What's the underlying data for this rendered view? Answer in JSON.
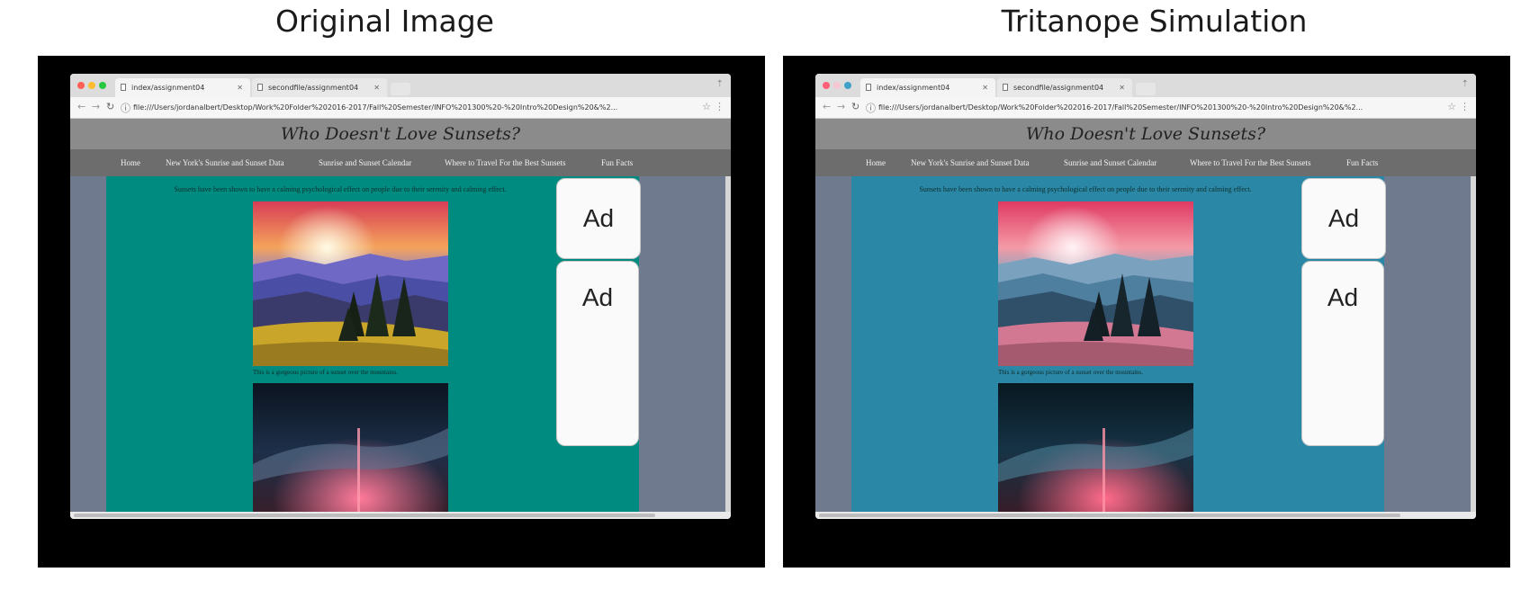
{
  "titles": {
    "left": "Original Image",
    "right": "Tritanope Simulation"
  },
  "browser": {
    "tabs": [
      "index/assignment04",
      "secondfile/assignment04"
    ],
    "url": "file:///Users/jordanalbert/Desktop/Work%20Folder%202016-2017/Fall%20Semester/INFO%201300%20-%20Intro%20Design%20&%2...",
    "site_title": "Who Doesn't Love Sunsets?",
    "nav": [
      "Home",
      "New York's Sunrise and Sunset Data",
      "Sunrise and Sunset Calendar",
      "Where to Travel For the Best Sunsets",
      "Fun Facts"
    ],
    "intro": "Sunsets have been shown to have a calming psychological effect on people due to their serenity and calming effect.",
    "caption": "This is a gorgeous picture of a sunset over the mountains.",
    "ad_labels": [
      "Ad",
      "Ad"
    ]
  },
  "colors": {
    "original_content_bg": "#008b80",
    "tritanope_content_bg": "#2b87a6"
  },
  "icons": [
    "doc-icon",
    "close-icon",
    "back-icon",
    "forward-icon",
    "reload-icon",
    "info-icon",
    "star-icon",
    "menu-icon",
    "profile-icon"
  ]
}
